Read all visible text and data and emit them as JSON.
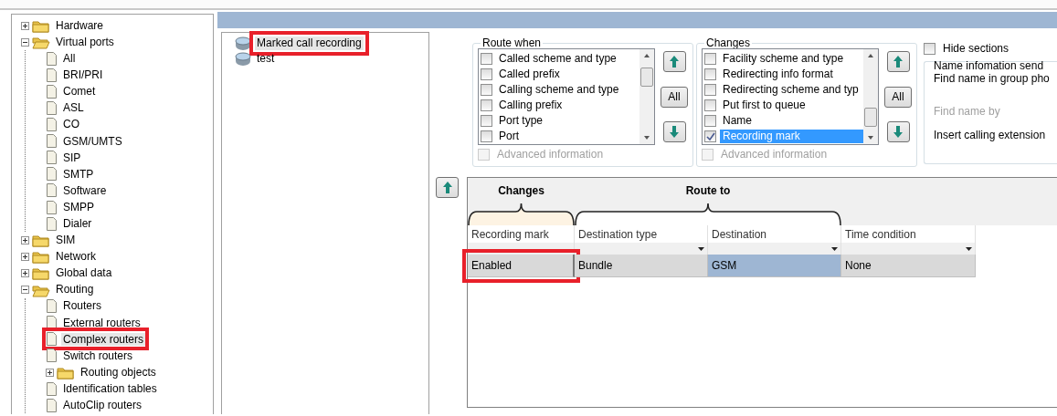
{
  "tree": [
    {
      "label": "Hardware",
      "kind": "folder",
      "expanded": false
    },
    {
      "label": "Virtual ports",
      "kind": "folder",
      "expanded": true,
      "children": [
        {
          "label": "All",
          "kind": "file"
        },
        {
          "label": "BRI/PRI",
          "kind": "file"
        },
        {
          "label": "Comet",
          "kind": "file"
        },
        {
          "label": "ASL",
          "kind": "file"
        },
        {
          "label": "CO",
          "kind": "file"
        },
        {
          "label": "GSM/UMTS",
          "kind": "file"
        },
        {
          "label": "SIP",
          "kind": "file"
        },
        {
          "label": "SMTP",
          "kind": "file"
        },
        {
          "label": "Software",
          "kind": "file"
        },
        {
          "label": "SMPP",
          "kind": "file"
        },
        {
          "label": "Dialer",
          "kind": "file"
        }
      ]
    },
    {
      "label": "SIM",
      "kind": "folder",
      "expanded": false
    },
    {
      "label": "Network",
      "kind": "folder",
      "expanded": false
    },
    {
      "label": "Global data",
      "kind": "folder",
      "expanded": false
    },
    {
      "label": "Routing",
      "kind": "folder",
      "expanded": true,
      "children": [
        {
          "label": "Routers",
          "kind": "file"
        },
        {
          "label": "External routers",
          "kind": "file"
        },
        {
          "label": "Complex routers",
          "kind": "file",
          "selected": true,
          "annotated": true
        },
        {
          "label": "Switch routers",
          "kind": "file"
        },
        {
          "label": "Routing objects",
          "kind": "folder",
          "expanded": false
        },
        {
          "label": "Identification tables",
          "kind": "file"
        },
        {
          "label": "AutoClip routers",
          "kind": "file"
        }
      ]
    }
  ],
  "routers": [
    {
      "label": "Marked call recording",
      "selected": true,
      "annotated": true
    },
    {
      "label": "test",
      "selected": false,
      "annotated": false
    }
  ],
  "groups": [
    {
      "title": "Route when",
      "items": [
        {
          "label": "Called scheme and type",
          "checked": false,
          "selected": false
        },
        {
          "label": "Called prefix",
          "checked": false,
          "selected": false
        },
        {
          "label": "Calling scheme and type",
          "checked": false,
          "selected": false
        },
        {
          "label": "Calling prefix",
          "checked": false,
          "selected": false
        },
        {
          "label": "Port type",
          "checked": false,
          "selected": false
        },
        {
          "label": "Port",
          "checked": false,
          "selected": false
        }
      ],
      "all_button": "All",
      "advanced": {
        "label": "Advanced information",
        "checked": false,
        "disabled": true
      }
    },
    {
      "title": "Changes",
      "items": [
        {
          "label": "Facility scheme and type",
          "checked": false,
          "selected": false
        },
        {
          "label": "Redirecting info format",
          "checked": false,
          "selected": false
        },
        {
          "label": "Redirecting scheme and typ",
          "checked": false,
          "selected": false
        },
        {
          "label": "Put first to queue",
          "checked": false,
          "selected": false
        },
        {
          "label": "Name",
          "checked": false,
          "selected": false
        },
        {
          "label": "Recording mark",
          "checked": true,
          "selected": true
        }
      ],
      "all_button": "All",
      "advanced": {
        "label": "Advanced information",
        "checked": false,
        "disabled": true
      }
    }
  ],
  "hide_sections": {
    "label": "Hide sections",
    "checked": false
  },
  "name_info": {
    "title": "Name infomation send",
    "rows": [
      {
        "label": "Find name in group pho",
        "disabled": false
      },
      {
        "label": "Find name by",
        "disabled": true
      },
      {
        "label": "Insert calling extension",
        "disabled": false
      }
    ]
  },
  "grid": {
    "bands": [
      {
        "label": "Changes",
        "highlighted": true
      },
      {
        "label": "Route to",
        "highlighted": false
      }
    ],
    "columns": [
      {
        "label": "Recording mark",
        "filter": false
      },
      {
        "label": "Destination type",
        "filter": true
      },
      {
        "label": "Destination",
        "filter": true
      },
      {
        "label": "Time condition",
        "filter": true
      }
    ],
    "rows": [
      {
        "cells": [
          {
            "text": "Enabled",
            "selected": false,
            "annotated": true
          },
          {
            "text": "Bundle",
            "selected": false,
            "annotated": false
          },
          {
            "text": "GSM",
            "selected": true,
            "annotated": false
          },
          {
            "text": "None",
            "selected": false,
            "annotated": false
          }
        ]
      }
    ]
  }
}
